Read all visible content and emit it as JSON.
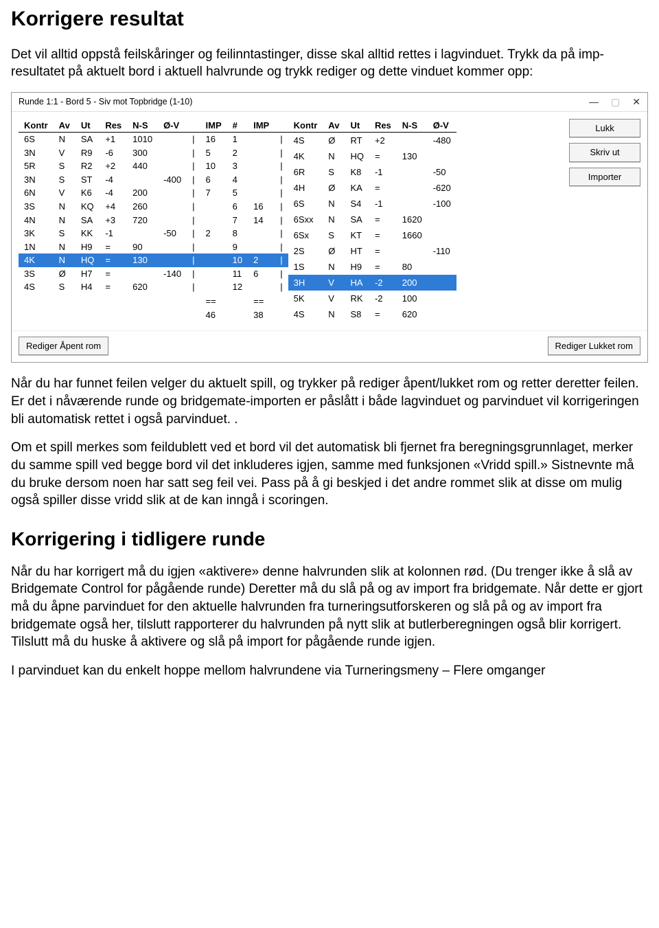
{
  "headings": {
    "h1": "Korrigere resultat",
    "h2": "Korrigering i tidligere runde"
  },
  "paras": {
    "p1": "Det vil alltid oppstå feilskåringer og feilinntastinger, disse skal alltid rettes i lagvinduet. Trykk da på imp-resultatet på aktuelt bord i aktuell halvrunde og trykk rediger og dette vinduet kommer opp:",
    "p2": "Når du har funnet feilen velger du aktuelt spill, og trykker på rediger åpent/lukket rom og retter deretter feilen. Er det i nåværende runde og bridgemate-importen er påslått i både lagvinduet og parvinduet vil korrigeringen bli automatisk rettet i også parvinduet.   .",
    "p3": "Om et spill merkes som feildublett ved et bord vil det automatisk bli fjernet fra beregningsgrunnlaget, merker du samme spill ved begge bord vil det inkluderes igjen, samme med funksjonen «Vridd spill.» Sistnevnte må du bruke dersom noen har satt seg feil vei. Pass på å gi beskjed i det andre rommet slik at disse om mulig også spiller disse vridd slik at de kan inngå i scoringen.",
    "p4": "Når du har korrigert må du igjen «aktivere» denne halvrunden slik at kolonnen rød. (Du trenger ikke å slå av Bridgemate Control for pågående runde) Deretter må du slå på og av import fra bridgemate. Når dette er gjort må du åpne parvinduet for den aktuelle halvrunden fra turneringsutforskeren og slå på og av import fra bridgemate også her, tilslutt rapporterer du halvrunden på nytt slik at butlerberegningen også blir korrigert. Tilslutt må du huske å aktivere og slå på import for pågående runde igjen.",
    "p5": "I parvinduet kan du enkelt hoppe mellom halvrundene via Turneringsmeny – Flere omganger"
  },
  "window": {
    "title": "Runde 1:1 - Bord 5 - Siv mot Topbridge (1-10)",
    "buttons": {
      "close": "Lukk",
      "print": "Skriv ut",
      "import": "Importer"
    },
    "bottom": {
      "editOpen": "Rediger Åpent rom",
      "editClosed": "Rediger Lukket rom"
    },
    "headers": {
      "kontr": "Kontr",
      "av": "Av",
      "ut": "Ut",
      "res": "Res",
      "ns": "N-S",
      "ov": "Ø-V",
      "imp": "IMP",
      "hash": "#",
      "imp2": "IMP"
    },
    "totals": {
      "eq": "==",
      "left": "46",
      "right": "38"
    },
    "left": [
      {
        "kontr": "6S",
        "av": "N",
        "ut": "SA",
        "res": "+1",
        "ns": "1010",
        "ov": "",
        "imp": "16"
      },
      {
        "kontr": "3N",
        "av": "V",
        "ut": "R9",
        "res": "-6",
        "ns": "300",
        "ov": "",
        "imp": "5"
      },
      {
        "kontr": "5R",
        "av": "S",
        "ut": "R2",
        "res": "+2",
        "ns": "440",
        "ov": "",
        "imp": "10"
      },
      {
        "kontr": "3N",
        "av": "S",
        "ut": "ST",
        "res": "-4",
        "ns": "",
        "ov": "-400",
        "imp": "6"
      },
      {
        "kontr": "6N",
        "av": "V",
        "ut": "K6",
        "res": "-4",
        "ns": "200",
        "ov": "",
        "imp": "7"
      },
      {
        "kontr": "3S",
        "av": "N",
        "ut": "KQ",
        "res": "+4",
        "ns": "260",
        "ov": "",
        "imp": ""
      },
      {
        "kontr": "4N",
        "av": "N",
        "ut": "SA",
        "res": "+3",
        "ns": "720",
        "ov": "",
        "imp": ""
      },
      {
        "kontr": "3K",
        "av": "S",
        "ut": "KK",
        "res": "-1",
        "ns": "",
        "ov": "-50",
        "imp": "2"
      },
      {
        "kontr": "1N",
        "av": "N",
        "ut": "H9",
        "res": "=",
        "ns": "90",
        "ov": "",
        "imp": ""
      },
      {
        "kontr": "4K",
        "av": "N",
        "ut": "HQ",
        "res": "=",
        "ns": "130",
        "ov": "",
        "imp": "",
        "hl": true
      },
      {
        "kontr": "3S",
        "av": "Ø",
        "ut": "H7",
        "res": "=",
        "ns": "",
        "ov": "-140",
        "imp": ""
      },
      {
        "kontr": "4S",
        "av": "S",
        "ut": "H4",
        "res": "=",
        "ns": "620",
        "ov": "",
        "imp": ""
      }
    ],
    "mid": [
      {
        "hash": "1",
        "imp": ""
      },
      {
        "hash": "2",
        "imp": ""
      },
      {
        "hash": "3",
        "imp": ""
      },
      {
        "hash": "4",
        "imp": ""
      },
      {
        "hash": "5",
        "imp": ""
      },
      {
        "hash": "6",
        "imp": "16"
      },
      {
        "hash": "7",
        "imp": "14"
      },
      {
        "hash": "8",
        "imp": ""
      },
      {
        "hash": "9",
        "imp": ""
      },
      {
        "hash": "10",
        "imp": "2",
        "hl": true
      },
      {
        "hash": "11",
        "imp": "6"
      },
      {
        "hash": "12",
        "imp": ""
      }
    ],
    "right": [
      {
        "kontr": "4S",
        "av": "Ø",
        "ut": "RT",
        "res": "+2",
        "ns": "",
        "ov": "-480"
      },
      {
        "kontr": "4K",
        "av": "N",
        "ut": "HQ",
        "res": "=",
        "ns": "130",
        "ov": ""
      },
      {
        "kontr": "6R",
        "av": "S",
        "ut": "K8",
        "res": "-1",
        "ns": "",
        "ov": "-50"
      },
      {
        "kontr": "4H",
        "av": "Ø",
        "ut": "KA",
        "res": "=",
        "ns": "",
        "ov": "-620"
      },
      {
        "kontr": "6S",
        "av": "N",
        "ut": "S4",
        "res": "-1",
        "ns": "",
        "ov": "-100"
      },
      {
        "kontr": "6Sxx",
        "av": "N",
        "ut": "SA",
        "res": "=",
        "ns": "1620",
        "ov": ""
      },
      {
        "kontr": "6Sx",
        "av": "S",
        "ut": "KT",
        "res": "=",
        "ns": "1660",
        "ov": ""
      },
      {
        "kontr": "2S",
        "av": "Ø",
        "ut": "HT",
        "res": "=",
        "ns": "",
        "ov": "-110"
      },
      {
        "kontr": "1S",
        "av": "N",
        "ut": "H9",
        "res": "=",
        "ns": "80",
        "ov": ""
      },
      {
        "kontr": "3H",
        "av": "V",
        "ut": "HA",
        "res": "-2",
        "ns": "200",
        "ov": "",
        "hl": true
      },
      {
        "kontr": "5K",
        "av": "V",
        "ut": "RK",
        "res": "-2",
        "ns": "100",
        "ov": ""
      },
      {
        "kontr": "4S",
        "av": "N",
        "ut": "S8",
        "res": "=",
        "ns": "620",
        "ov": ""
      }
    ]
  }
}
